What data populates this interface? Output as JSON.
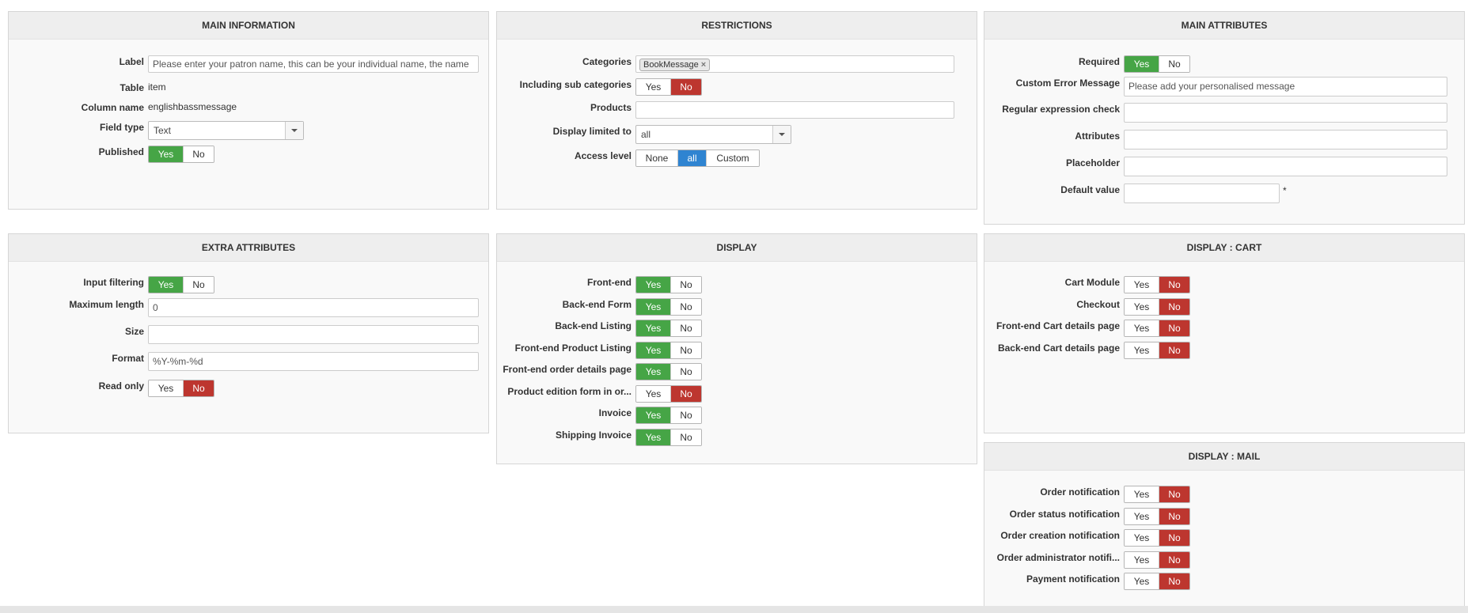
{
  "main_info": {
    "title": "MAIN INFORMATION",
    "label_label": "Label",
    "label_value": "Please enter your patron name, this can be your individual name, the name",
    "table_label": "Table",
    "table_value": "item",
    "column_label": "Column name",
    "column_value": "englishbassmessage",
    "fieldtype_label": "Field type",
    "fieldtype_value": "Text",
    "published_label": "Published",
    "published_yes": "Yes",
    "published_no": "No"
  },
  "restrictions": {
    "title": "RESTRICTIONS",
    "categories_label": "Categories",
    "categories_tag": "BookMessage",
    "subcat_label": "Including sub categories",
    "subcat_yes": "Yes",
    "subcat_no": "No",
    "products_label": "Products",
    "display_limited_label": "Display limited to",
    "display_limited_value": "all",
    "access_label": "Access level",
    "access_none": "None",
    "access_all": "all",
    "access_custom": "Custom"
  },
  "main_attributes": {
    "title": "MAIN ATTRIBUTES",
    "required_label": "Required",
    "required_yes": "Yes",
    "required_no": "No",
    "custom_error_label": "Custom Error Message",
    "custom_error_value": "Please add your personalised message",
    "regex_label": "Regular expression check",
    "attributes_label": "Attributes",
    "placeholder_label": "Placeholder",
    "default_label": "Default value",
    "default_star": "*"
  },
  "extra_attributes": {
    "title": "EXTRA ATTRIBUTES",
    "input_filtering_label": "Input filtering",
    "input_filtering_yes": "Yes",
    "input_filtering_no": "No",
    "maxlen_label": "Maximum length",
    "maxlen_value": "0",
    "size_label": "Size",
    "format_label": "Format",
    "format_value": "%Y-%m-%d",
    "readonly_label": "Read only",
    "readonly_yes": "Yes",
    "readonly_no": "No"
  },
  "display": {
    "title": "DISPLAY",
    "rows": [
      {
        "label": "Front-end",
        "yes": "Yes",
        "no": "No",
        "state": "yes"
      },
      {
        "label": "Back-end Form",
        "yes": "Yes",
        "no": "No",
        "state": "yes"
      },
      {
        "label": "Back-end Listing",
        "yes": "Yes",
        "no": "No",
        "state": "yes"
      },
      {
        "label": "Front-end Product Listing",
        "yes": "Yes",
        "no": "No",
        "state": "yes"
      },
      {
        "label": "Front-end order details page",
        "yes": "Yes",
        "no": "No",
        "state": "yes"
      },
      {
        "label": "Product edition form in or...",
        "yes": "Yes",
        "no": "No",
        "state": "no"
      },
      {
        "label": "Invoice",
        "yes": "Yes",
        "no": "No",
        "state": "yes"
      },
      {
        "label": "Shipping Invoice",
        "yes": "Yes",
        "no": "No",
        "state": "yes"
      }
    ]
  },
  "display_cart": {
    "title": "DISPLAY : CART",
    "rows": [
      {
        "label": "Cart Module",
        "yes": "Yes",
        "no": "No",
        "state": "no"
      },
      {
        "label": "Checkout",
        "yes": "Yes",
        "no": "No",
        "state": "no"
      },
      {
        "label": "Front-end Cart details page",
        "yes": "Yes",
        "no": "No",
        "state": "no"
      },
      {
        "label": "Back-end Cart details page",
        "yes": "Yes",
        "no": "No",
        "state": "no"
      }
    ]
  },
  "display_mail": {
    "title": "DISPLAY : MAIL",
    "rows": [
      {
        "label": "Order notification",
        "yes": "Yes",
        "no": "No",
        "state": "no"
      },
      {
        "label": "Order status notification",
        "yes": "Yes",
        "no": "No",
        "state": "no"
      },
      {
        "label": "Order creation notification",
        "yes": "Yes",
        "no": "No",
        "state": "no"
      },
      {
        "label": "Order administrator notifi...",
        "yes": "Yes",
        "no": "No",
        "state": "no"
      },
      {
        "label": "Payment notification",
        "yes": "Yes",
        "no": "No",
        "state": "no"
      }
    ]
  },
  "colors": {
    "yes_active": "#46a546",
    "no_active": "#bd362f",
    "blue_active": "#2f84d1"
  }
}
